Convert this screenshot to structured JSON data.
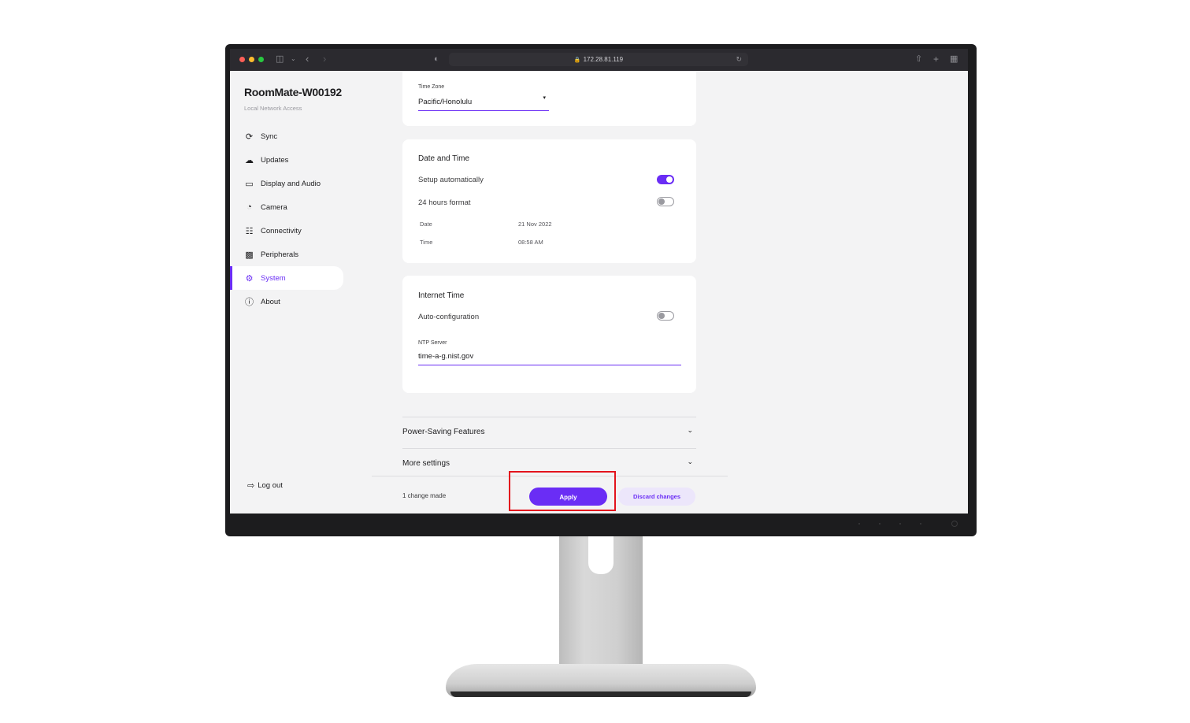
{
  "browser": {
    "url": "172.28.81.119"
  },
  "sidebar": {
    "device_name": "RoomMate-W00192",
    "subtitle": "Local Network Access",
    "items": [
      {
        "label": "Sync",
        "icon": "sync-icon"
      },
      {
        "label": "Updates",
        "icon": "cloud-download-icon"
      },
      {
        "label": "Display and Audio",
        "icon": "monitor-icon"
      },
      {
        "label": "Camera",
        "icon": "camera-icon"
      },
      {
        "label": "Connectivity",
        "icon": "network-icon"
      },
      {
        "label": "Peripherals",
        "icon": "peripherals-icon"
      },
      {
        "label": "System",
        "icon": "gear-icon",
        "active": true
      },
      {
        "label": "About",
        "icon": "info-icon"
      }
    ],
    "logout_label": "Log out"
  },
  "timezone_card": {
    "label": "Time Zone",
    "value": "Pacific/Honolulu"
  },
  "date_time_card": {
    "title": "Date and Time",
    "setup_auto_label": "Setup automatically",
    "setup_auto_on": true,
    "hours24_label": "24 hours format",
    "hours24_on": false,
    "date_label": "Date",
    "date_value": "21 Nov 2022",
    "time_label": "Time",
    "time_value": "08:58 AM"
  },
  "internet_time_card": {
    "title": "Internet Time",
    "auto_config_label": "Auto-configuration",
    "auto_config_on": false,
    "ntp_label": "NTP Server",
    "ntp_value": "time-a-g.nist.gov"
  },
  "accordions": [
    {
      "label": "Power-Saving Features"
    },
    {
      "label": "More settings"
    }
  ],
  "footer": {
    "changes_text": "1 change made",
    "apply_label": "Apply",
    "discard_label": "Discard changes"
  },
  "colors": {
    "accent": "#6a2df5",
    "highlight_box": "#e3141d"
  }
}
